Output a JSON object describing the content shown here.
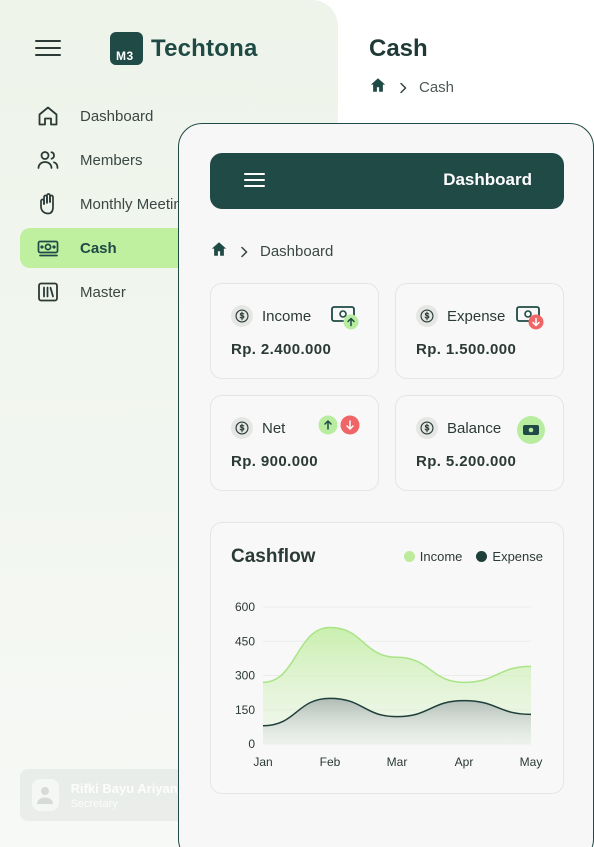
{
  "sidebar": {
    "brand": {
      "mark": "M3",
      "name": "Techtona"
    },
    "items": [
      {
        "label": "Dashboard",
        "icon": "home-icon"
      },
      {
        "label": "Members",
        "icon": "users-icon"
      },
      {
        "label": "Monthly Meetings",
        "icon": "hand-icon"
      },
      {
        "label": "Cash",
        "icon": "cash-icon",
        "active": true
      },
      {
        "label": "Master",
        "icon": "library-icon"
      }
    ],
    "user": {
      "name": "Rifki Bayu Ariyanto",
      "role": "Secretary"
    }
  },
  "page": {
    "title": "Cash",
    "breadcrumb": [
      "Cash"
    ]
  },
  "mobile": {
    "header_title": "Dashboard",
    "breadcrumb": [
      "Dashboard"
    ],
    "stats": {
      "income": {
        "label": "Income",
        "value": "Rp. 2.400.000"
      },
      "expense": {
        "label": "Expense",
        "value": "Rp. 1.500.000"
      },
      "net": {
        "label": "Net",
        "value": "Rp. 900.000"
      },
      "balance": {
        "label": "Balance",
        "value": "Rp. 5.200.000"
      }
    }
  },
  "colors": {
    "brand": "#1f4a45",
    "active_nav": "#bff0a0",
    "income": "#bdeb9c",
    "expense": "#1f3f3a",
    "up": "#b8eda0",
    "down": "#f06666"
  },
  "chart_data": {
    "type": "area",
    "title": "Cashflow",
    "categories": [
      "Jan",
      "Feb",
      "Mar",
      "Apr",
      "May"
    ],
    "series": [
      {
        "name": "Income",
        "values": [
          270,
          510,
          380,
          270,
          340
        ]
      },
      {
        "name": "Expense",
        "values": [
          80,
          200,
          120,
          190,
          130
        ]
      }
    ],
    "yticks": [
      0,
      150,
      300,
      450,
      600
    ],
    "ylim": [
      0,
      600
    ],
    "legend": "top-right",
    "grid": true
  }
}
